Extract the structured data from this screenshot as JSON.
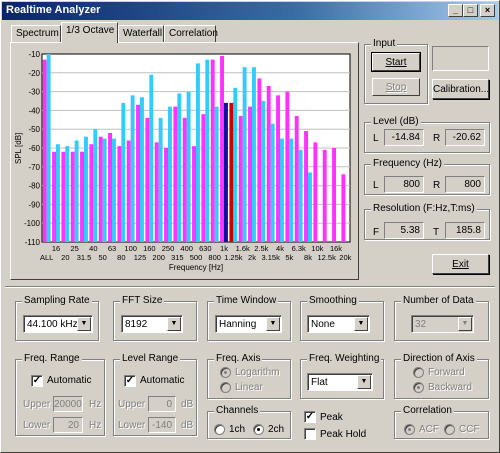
{
  "window": {
    "title": "Realtime Analyzer",
    "controls": [
      "_",
      "□",
      "×"
    ]
  },
  "tabs": [
    "Spectrum",
    "1/3 Octave",
    "Waterfall",
    "Correlation"
  ],
  "chart_data": {
    "type": "bar",
    "ylabel": "SPL [dB]",
    "xlabel": "Frequency [Hz]",
    "yticks": [
      "-10",
      "-20",
      "-30",
      "-40",
      "-50",
      "-60",
      "-70",
      "-80",
      "-90",
      "-100",
      "-110"
    ],
    "ylim": [
      -110,
      -10
    ],
    "xticks_top": [
      "16",
      "25",
      "40",
      "63",
      "100",
      "160",
      "250",
      "400",
      "630",
      "1k",
      "1.6k",
      "2.5k",
      "4k",
      "6.3k",
      "10k",
      "16k"
    ],
    "xticks_bottom": [
      "ALL",
      "20",
      "31.5",
      "50",
      "80",
      "125",
      "200",
      "315",
      "500",
      "800",
      "1.25k",
      "2k",
      "3.15k",
      "5k",
      "8k",
      "12.5k",
      "20k"
    ],
    "grid": true,
    "series": [
      {
        "color": "#ff33ff",
        "values": [
          -13,
          -62,
          -62,
          -62,
          -62,
          -58,
          -54,
          -52,
          -59,
          -56,
          -37,
          -44,
          -57,
          -60,
          -38,
          -44,
          -59,
          -42,
          -13,
          -11,
          -36,
          -43,
          -38,
          -23,
          -27,
          -32,
          -30,
          -43,
          -51,
          -57,
          -61,
          -60,
          -74
        ]
      },
      {
        "color": "#33ccff",
        "values": [
          -10,
          -58,
          -59,
          -56,
          -54,
          -50,
          -55,
          -55,
          -36,
          -32,
          -33,
          -21,
          -44,
          -38,
          -31,
          -30,
          -15,
          -13,
          -38,
          -36,
          -28,
          -17,
          -17,
          -35,
          -47,
          -55,
          -55,
          -61,
          -73
        ]
      }
    ],
    "highlight": {
      "blue_index": 19,
      "red_index": 20,
      "blue_color": "#1010a0",
      "red_color": "#cc0000"
    }
  },
  "input": {
    "label": "Input",
    "start": "Start",
    "stop": "Stop",
    "calibration": "Calibration..."
  },
  "level": {
    "label": "Level (dB)",
    "l_label": "L",
    "l_value": "-14.84",
    "r_label": "R",
    "r_value": "-20.62"
  },
  "frequency": {
    "label": "Frequency (Hz)",
    "l_label": "L",
    "l_value": "800",
    "r_label": "R",
    "r_value": "800"
  },
  "resolution": {
    "label": "Resolution (F:Hz,T:ms)",
    "f_label": "F",
    "f_value": "5.38",
    "t_label": "T",
    "t_value": "185.8"
  },
  "exit": "Exit",
  "sampling": {
    "label": "Sampling Rate",
    "value": "44.100 kHz"
  },
  "fft": {
    "label": "FFT Size",
    "value": "8192"
  },
  "timewindow": {
    "label": "Time Window",
    "value": "Hanning"
  },
  "smoothing": {
    "label": "Smoothing",
    "value": "None"
  },
  "numdata": {
    "label": "Number of Data",
    "value": "32"
  },
  "freqrange": {
    "label": "Freq. Range",
    "auto": "Automatic",
    "upper_label": "Upper",
    "upper_value": "20000",
    "upper_unit": "Hz",
    "lower_label": "Lower",
    "lower_value": "20",
    "lower_unit": "Hz"
  },
  "levelrange": {
    "label": "Level Range",
    "auto": "Automatic",
    "upper_label": "Upper",
    "upper_value": "0",
    "upper_unit": "dB",
    "lower_label": "Lower",
    "lower_value": "-140",
    "lower_unit": "dB"
  },
  "freqaxis": {
    "label": "Freq. Axis",
    "opt1": "Logarithm",
    "opt2": "Linear"
  },
  "freqweight": {
    "label": "Freq. Weighting",
    "value": "Flat"
  },
  "direction": {
    "label": "Direction of Axis",
    "opt1": "Forward",
    "opt2": "Backward"
  },
  "channels": {
    "label": "Channels",
    "opt1": "1ch",
    "opt2": "2ch"
  },
  "peak": {
    "peak": "Peak",
    "hold": "Peak Hold"
  },
  "correlation": {
    "label": "Correlation",
    "opt1": "ACF",
    "opt2": "CCF"
  }
}
